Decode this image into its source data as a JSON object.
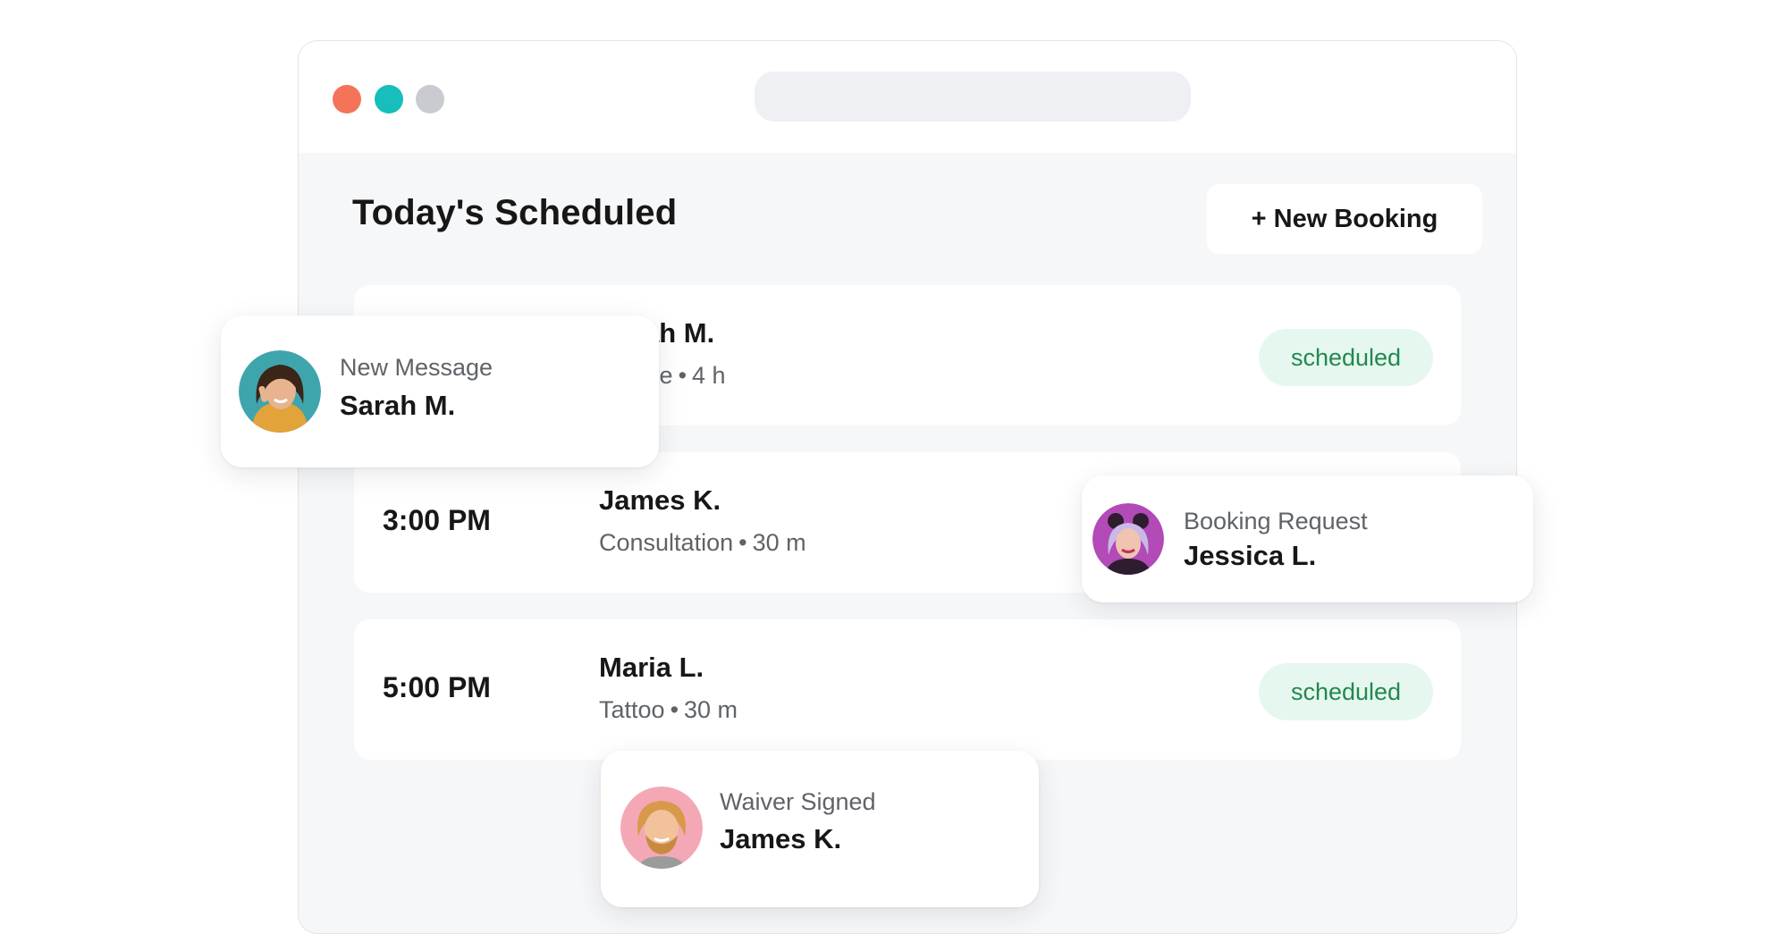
{
  "header": {
    "title": "Today's Scheduled",
    "new_booking_label": "+ New Booking"
  },
  "appointments": [
    {
      "time": "",
      "name": "Sarah M.",
      "service": "Sleeve",
      "duration": "4 h",
      "status": "scheduled"
    },
    {
      "time": "3:00 PM",
      "name": "James K.",
      "service": "Consultation",
      "duration": "30 m",
      "status": ""
    },
    {
      "time": "5:00 PM",
      "name": "Maria L.",
      "service": "Tattoo",
      "duration": "30 m",
      "status": "scheduled"
    }
  ],
  "notifications": [
    {
      "kind": "New Message",
      "name": "Sarah M."
    },
    {
      "kind": "Booking Request",
      "name": "Jessica L."
    },
    {
      "kind": "Waiver Signed",
      "name": "James K."
    }
  ],
  "meta_separator": "•",
  "colors": {
    "close_dot": "#f4745a",
    "minimize_dot": "#17bebb",
    "maximize_dot": "#c9cbd1",
    "status_bg": "#e6f7ef",
    "status_text": "#22884f"
  }
}
